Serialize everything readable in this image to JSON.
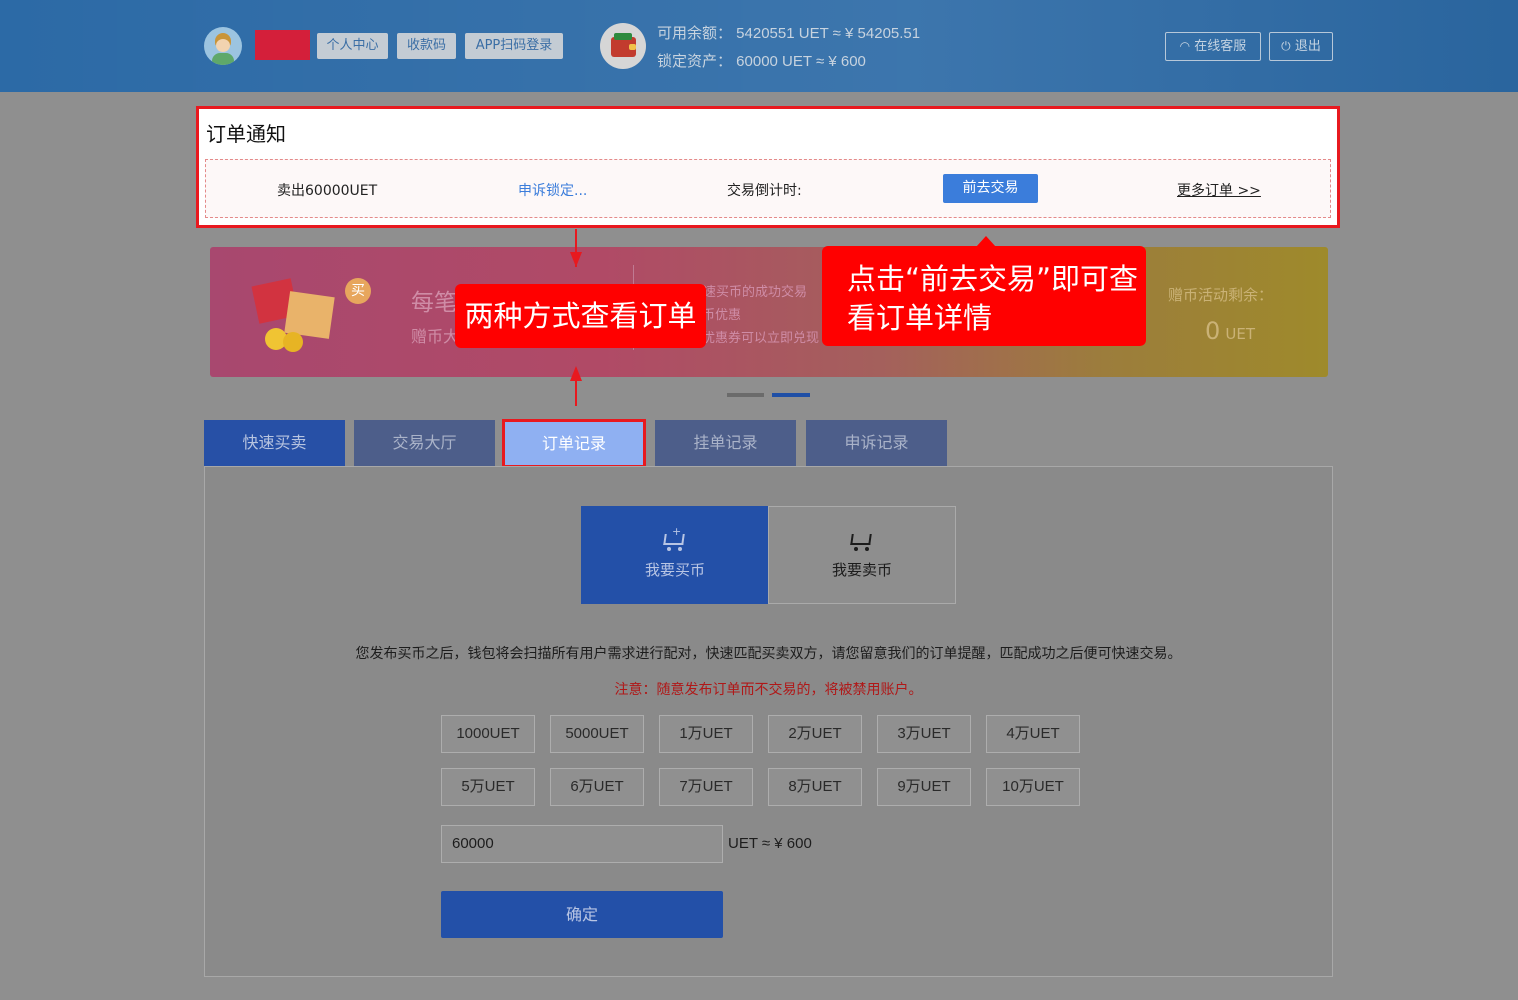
{
  "header": {
    "nav_buttons": [
      "个人中心",
      "收款码",
      "APP扫码登录"
    ],
    "available_balance": "可用余额： 5420551 UET ≈ ¥ 54205.51",
    "locked_assets": "锁定资产： 60000 UET ≈ ¥ 600",
    "support_label": "在线客服",
    "logout_label": "退出"
  },
  "notice": {
    "title": "订单通知",
    "order_text": "卖出60000UET",
    "status_link": "申诉锁定...",
    "countdown_label": "交易倒计时:",
    "go_trade_button": "前去交易",
    "more_orders_link": "更多订单 >>"
  },
  "banner": {
    "badge": "买",
    "headline_partial": "每笔",
    "sub_partial": "赠币大",
    "line1_partial": "快速买币的成功交易",
    "line2_partial": "币优惠",
    "line3_partial": "优惠券可以立即兑现",
    "gift_label": "赠币活动剩余：",
    "gift_value": "0",
    "gift_unit": "UET"
  },
  "annotations": {
    "left_callout": "两种方式查看订单",
    "right_callout_line1": "点击“前去交易”即可查",
    "right_callout_line2": "看订单详情"
  },
  "tabs": [
    "快速买卖",
    "交易大厅",
    "订单记录",
    "挂单记录",
    "申诉记录"
  ],
  "trade_panel": {
    "buy_label": "我要买币",
    "sell_label": "我要卖币",
    "description": "您发布买币之后，钱包将会扫描所有用户需求进行配对，快速匹配买卖双方，请您留意我们的订单提醒，匹配成功之后便可快速交易。",
    "warning": "注意：随意发布订单而不交易的，将被禁用账户。",
    "amount_options": [
      "1000UET",
      "5000UET",
      "1万UET",
      "2万UET",
      "3万UET",
      "4万UET",
      "5万UET",
      "6万UET",
      "7万UET",
      "8万UET",
      "9万UET",
      "10万UET"
    ],
    "amount_value": "60000",
    "conversion": "UET ≈ ¥ 600",
    "confirm_button": "确定"
  },
  "colors": {
    "header_blue": "#2c6aa6",
    "highlight_red": "#e8191f",
    "primary_blue": "#2350a8",
    "go_button_blue": "#3b7ddb",
    "warning_red": "#b01818"
  }
}
